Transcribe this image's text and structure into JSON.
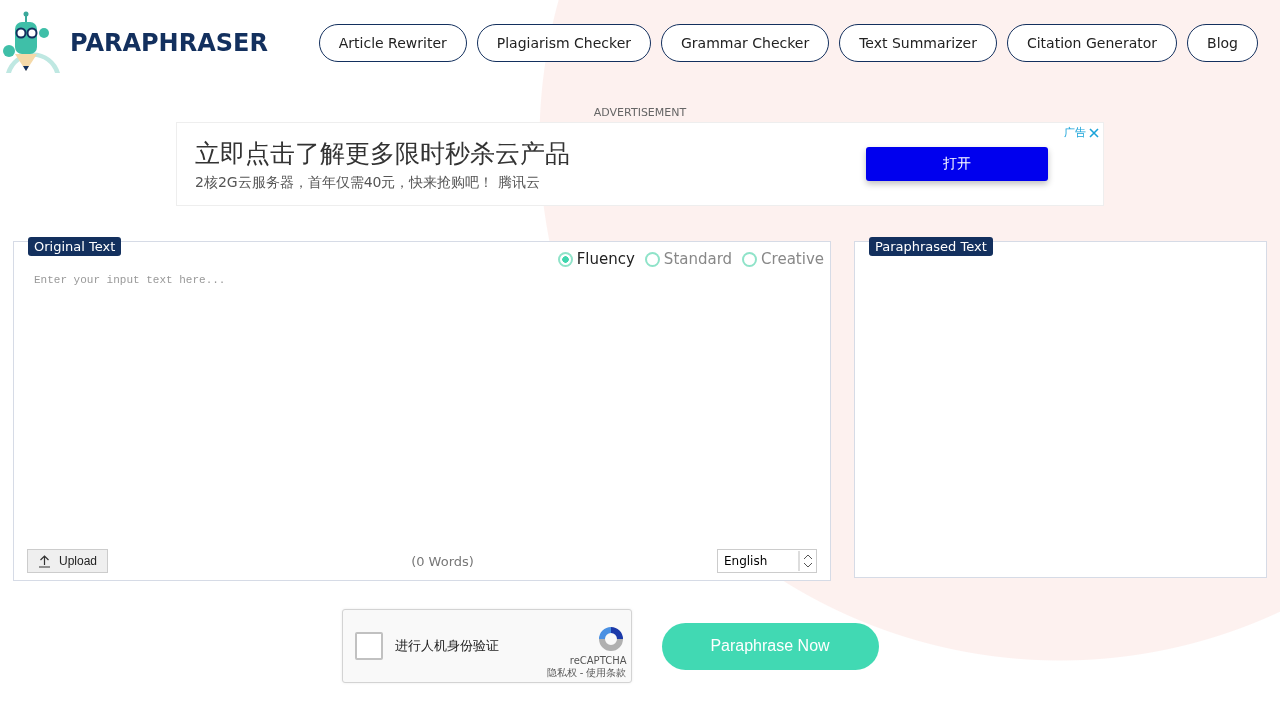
{
  "header": {
    "logo_text": "PARAPHRASER",
    "nav": [
      {
        "label": "Article Rewriter"
      },
      {
        "label": "Plagiarism Checker"
      },
      {
        "label": "Grammar Checker"
      },
      {
        "label": "Text Summarizer"
      },
      {
        "label": "Citation Generator"
      },
      {
        "label": "Blog"
      }
    ]
  },
  "ad": {
    "label": "ADVERTISEMENT",
    "headline": "立即点击了解更多限时秒杀云产品",
    "subline": "2核2G云服务器，首年仅需40元，快来抢购吧！ 腾讯云",
    "tag": "广告",
    "button": "打开"
  },
  "input_panel": {
    "title": "Original Text",
    "modes": [
      {
        "label": "Fluency",
        "selected": true
      },
      {
        "label": "Standard",
        "selected": false
      },
      {
        "label": "Creative",
        "selected": false
      }
    ],
    "placeholder": "Enter your input text here...",
    "upload": "Upload",
    "word_count": "(0 Words)",
    "language": "English"
  },
  "output_panel": {
    "title": "Paraphrased Text"
  },
  "captcha": {
    "label": "进行人机身份验证",
    "checked": false,
    "brand": "reCAPTCHA",
    "links": "隐私权 - 使用条款"
  },
  "submit": "Paraphrase Now"
}
